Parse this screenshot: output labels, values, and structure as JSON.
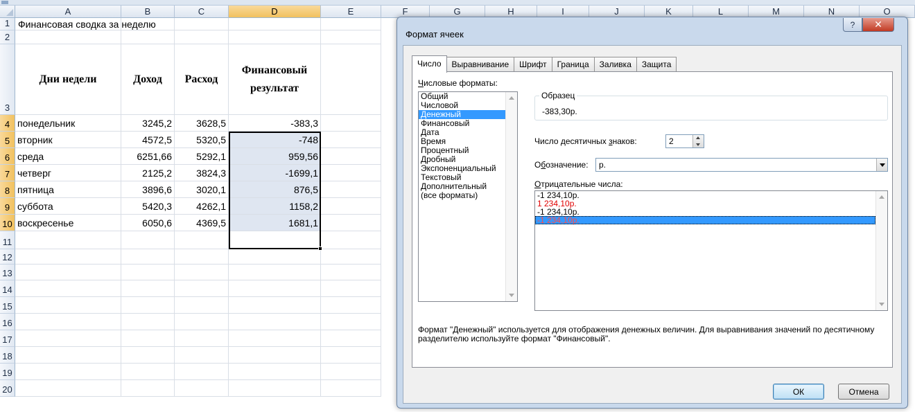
{
  "sheet": {
    "columns": [
      "A",
      "B",
      "C",
      "D",
      "E",
      "F",
      "G",
      "H",
      "I",
      "J",
      "K",
      "L",
      "M",
      "N",
      "O"
    ],
    "rows": [
      "1",
      "2",
      "3",
      "4",
      "5",
      "6",
      "7",
      "8",
      "9",
      "10",
      "11",
      "12",
      "13",
      "14",
      "15",
      "16",
      "17",
      "18",
      "19",
      "20"
    ],
    "title": "Финансовая сводка за неделю",
    "headers": {
      "days": "Дни недели",
      "income": "Доход",
      "expense": "Расход",
      "result": "Финансовый результат"
    },
    "data": [
      {
        "day": "понедельник",
        "income": "3245,2",
        "expense": "3628,5",
        "result": "-383,3"
      },
      {
        "day": "вторник",
        "income": "4572,5",
        "expense": "5320,5",
        "result": "-748"
      },
      {
        "day": "среда",
        "income": "6251,66",
        "expense": "5292,1",
        "result": "959,56"
      },
      {
        "day": "четверг",
        "income": "2125,2",
        "expense": "3824,3",
        "result": "-1699,1"
      },
      {
        "day": "пятница",
        "income": "3896,6",
        "expense": "3020,1",
        "result": "876,5"
      },
      {
        "day": "суббота",
        "income": "5420,3",
        "expense": "4262,1",
        "result": "1158,2"
      },
      {
        "day": "воскресенье",
        "income": "6050,6",
        "expense": "4369,5",
        "result": "1681,1"
      }
    ]
  },
  "dialog": {
    "title": "Формат ячеек",
    "help": "?",
    "close": "✕",
    "tabs": [
      "Число",
      "Выравнивание",
      "Шрифт",
      "Граница",
      "Заливка",
      "Защита"
    ],
    "active_tab": "Число",
    "formats_label": "Числовые форматы:",
    "formats": [
      "Общий",
      "Числовой",
      "Денежный",
      "Финансовый",
      "Дата",
      "Время",
      "Процентный",
      "Дробный",
      "Экспоненциальный",
      "Текстовый",
      "Дополнительный",
      "(все форматы)"
    ],
    "selected_format": "Денежный",
    "sample_label": "Образец",
    "sample_value": "-383,30р.",
    "decimals_label": "Число десятичных знаков:",
    "decimals_value": "2",
    "symbol_label": "Обозначение:",
    "symbol_value": "р.",
    "negative_label": "Отрицательные числа:",
    "negative_options": [
      {
        "text": "-1 234,10р.",
        "style": "black"
      },
      {
        "text": "1 234,10р.",
        "style": "red"
      },
      {
        "text": "-1 234,10р.",
        "style": "black"
      },
      {
        "text": "-1 234,10р.",
        "style": "red"
      }
    ],
    "selected_negative": 3,
    "description": "Формат \"Денежный\" используется для отображения денежных величин. Для выравнивания значений по десятичному разделителю используйте формат \"Финансовый\".",
    "ok": "ОК",
    "cancel": "Отмена"
  }
}
